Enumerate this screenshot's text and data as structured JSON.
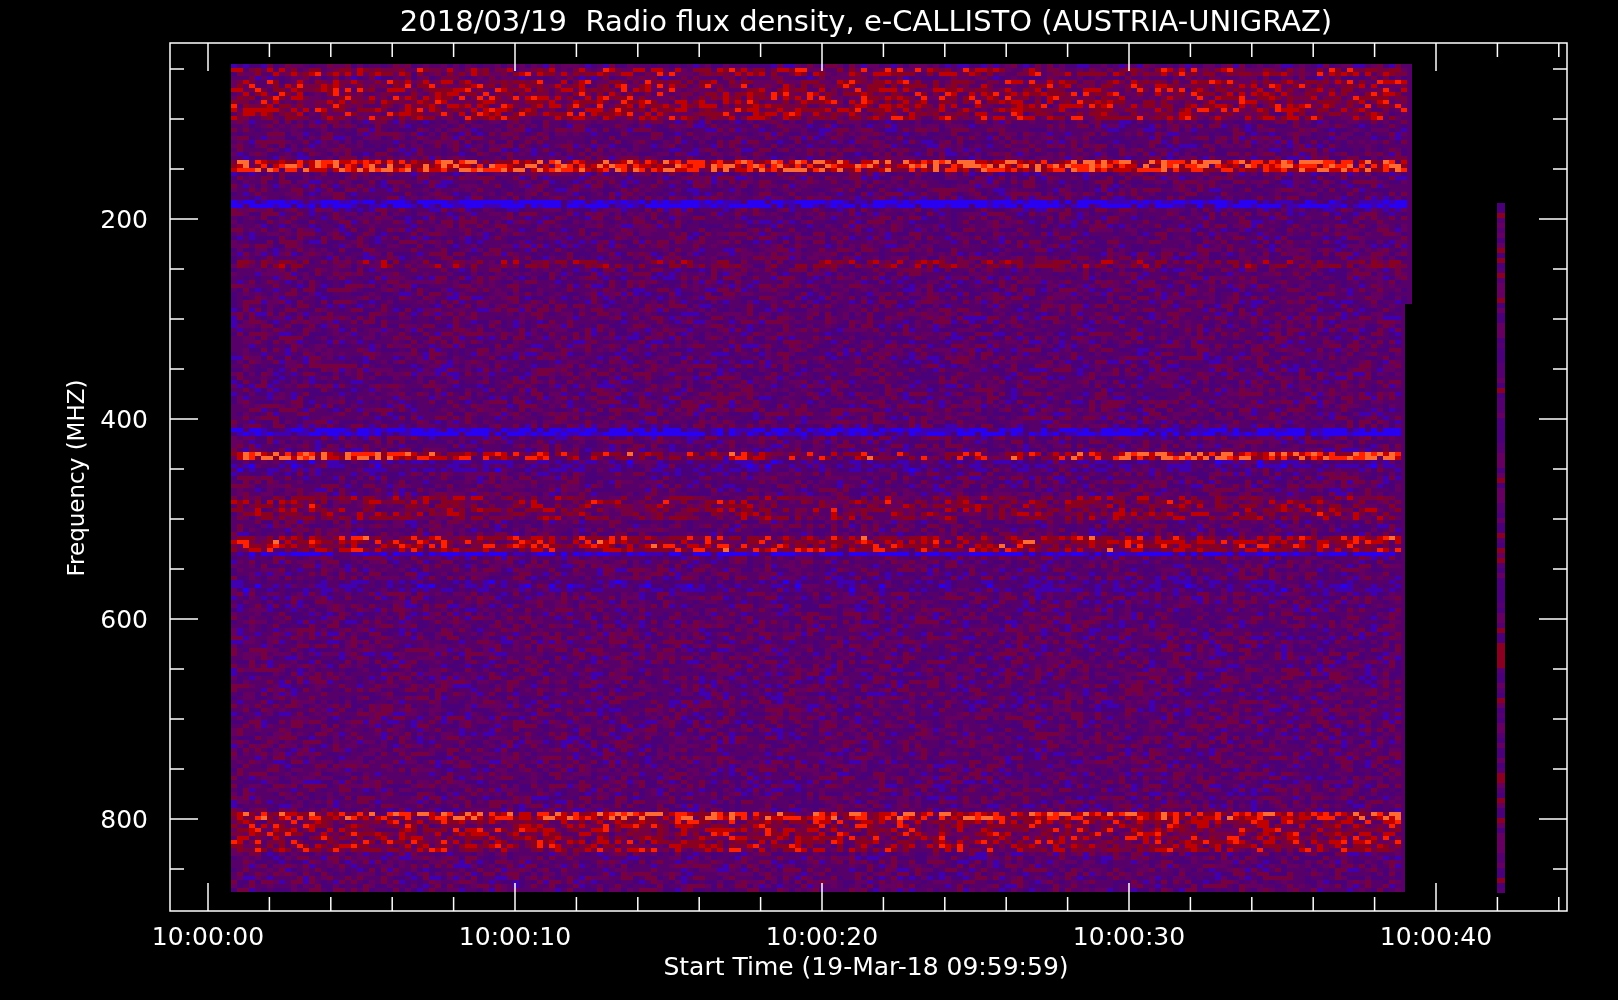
{
  "title": "2018/03/19  Radio flux density, e-CALLISTO (AUSTRIA-UNIGRAZ)",
  "y_axis": {
    "label": "Frequency (MHZ)",
    "ticks": [
      "200",
      "400",
      "600",
      "800"
    ]
  },
  "x_axis": {
    "label": "Start Time (19-Mar-18 09:59:59)",
    "ticks": [
      "10:00:00",
      "10:00:10",
      "10:00:20",
      "10:00:30",
      "10:00:40"
    ]
  }
}
